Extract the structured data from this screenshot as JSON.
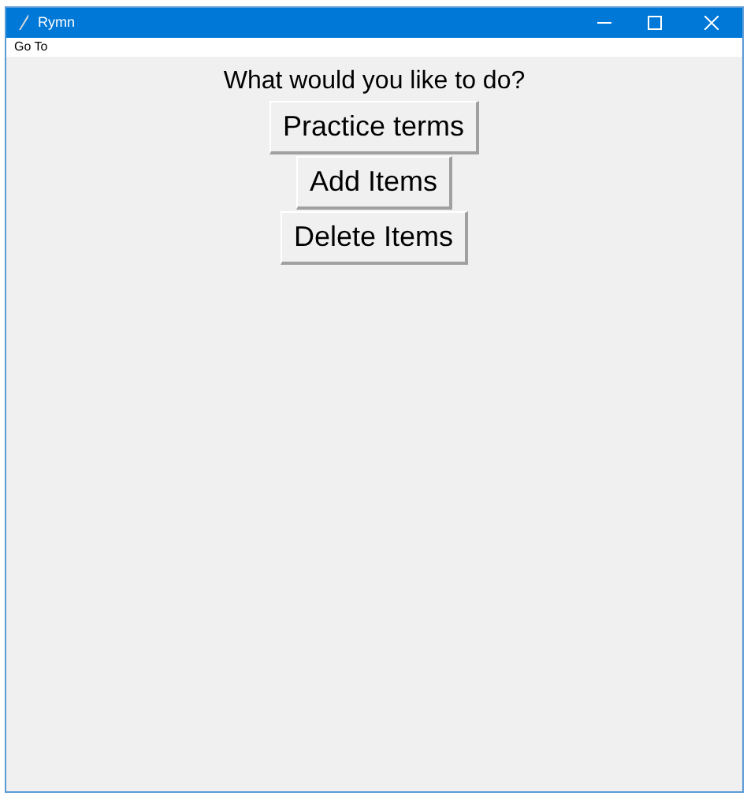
{
  "window": {
    "title": "Rymn"
  },
  "menu_bar": {
    "items": [
      "Go To"
    ]
  },
  "prompt": "What would you like to do?",
  "buttons": [
    "Practice terms",
    "Add Items",
    "Delete Items"
  ]
}
